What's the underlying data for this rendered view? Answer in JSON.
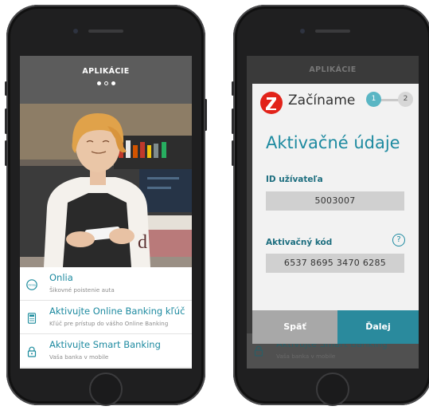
{
  "left_screen": {
    "header_title": "APLIKÁCIE",
    "hero_sign_letter": "d",
    "items": [
      {
        "title": "Onlia",
        "subtitle": "Šikovné poistenie auta",
        "icon": "onlia-logo-icon",
        "icon_text": "Onlia"
      },
      {
        "title": "Aktivujte Online Banking kľúč",
        "subtitle": "Kľúč pre prístup do vášho Online Banking",
        "icon": "calculator-icon"
      },
      {
        "title": "Aktivujte Smart Banking",
        "subtitle": "Vaša banka v mobile",
        "icon": "lock-icon"
      }
    ]
  },
  "right_screen": {
    "header_title": "APLIKÁCIE",
    "brand": "Začíname",
    "steps": [
      "1",
      "2"
    ],
    "dialog_title": "Aktivačné údaje",
    "user_id_label": "ID užívateľa",
    "user_id_value": "5003007",
    "activation_code_label": "Aktivačný kód",
    "activation_code_value": "6537 8695 3470 6285",
    "help_symbol": "?",
    "back_label": "Späť",
    "next_label": "Ďalej",
    "background_item": {
      "title": "Aktivujte Smart Banking",
      "subtitle": "Vaša banka v mobile"
    }
  },
  "colors": {
    "accent": "#1d8aa0",
    "brand_red": "#e2231a",
    "header_gray": "#5c5c5c"
  }
}
